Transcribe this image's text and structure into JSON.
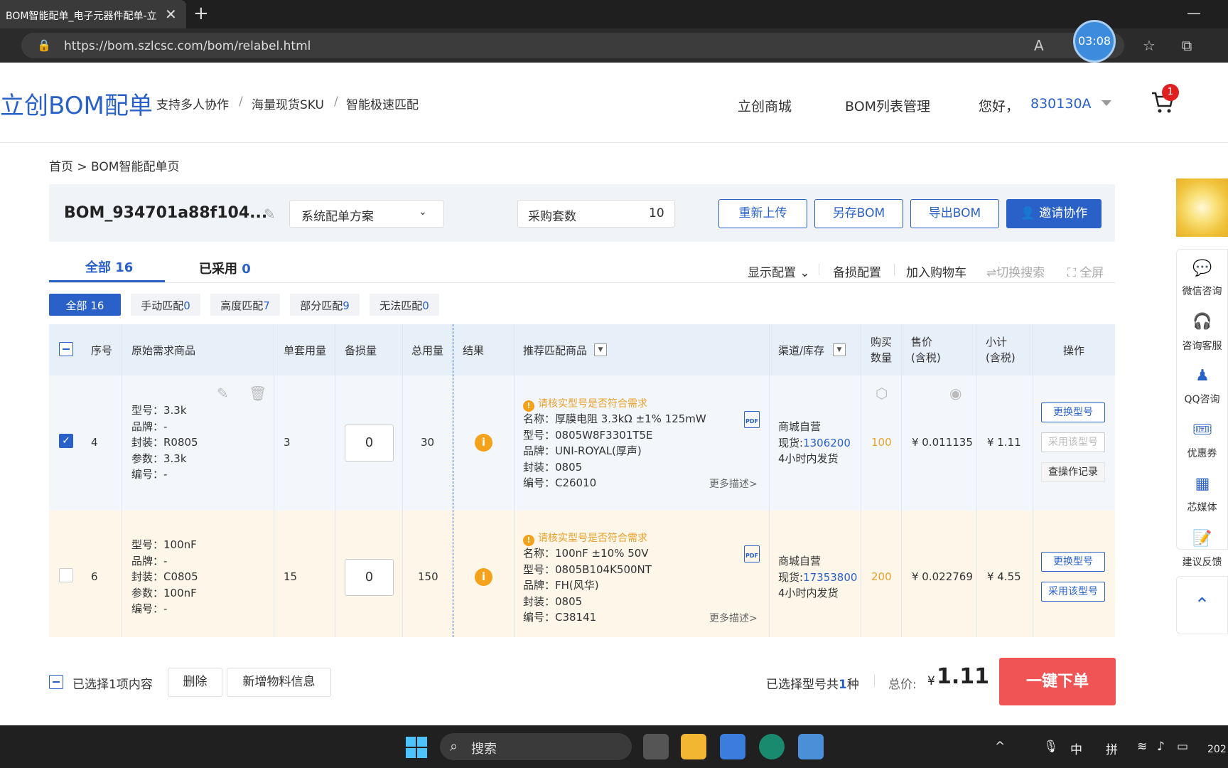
{
  "browser": {
    "tab_title": "BOM智能配单_电子元器件配单-立",
    "url": "https://bom.szlcsc.com/bom/relabel.html",
    "timer": "03:08"
  },
  "header": {
    "logo": "立创BOM配单",
    "slogans": [
      "支持多人协作",
      "/",
      "海量现货SKU",
      "/",
      "智能极速匹配"
    ],
    "nav": [
      "立创商城",
      "BOM列表管理"
    ],
    "greeting": "您好，",
    "user": "830130A",
    "cart_count": "1"
  },
  "breadcrumb": "首页 > BOM智能配单页",
  "bom": {
    "name": "BOM_934701a88f104...",
    "scheme": "系统配单方案",
    "qty_label": "采购套数",
    "qty_value": "10",
    "buttons": [
      "重新上传",
      "另存BOM",
      "导出BOM",
      "邀请协作"
    ]
  },
  "tabs": {
    "all_label": "全部 16",
    "used_label": "已采用 ",
    "used_count": "0"
  },
  "toolbar": [
    "显示配置",
    "备损配置",
    "加入购物车",
    "⇌切换搜索",
    "全屏"
  ],
  "chips": [
    {
      "label": "全部",
      "count": "16"
    },
    {
      "label": "手动匹配",
      "count": "0"
    },
    {
      "label": "高度匹配",
      "count": "7"
    },
    {
      "label": "部分匹配",
      "count": "9"
    },
    {
      "label": "无法匹配",
      "count": "0"
    }
  ],
  "columns": {
    "seq": "序号",
    "orig": "原始需求商品",
    "unit": "单套用量",
    "spare": "备损量",
    "total": "总用量",
    "result": "结果",
    "recommend": "推荐匹配商品",
    "channel": "渠道/库存",
    "buy1": "购买",
    "buy2": "数量",
    "price1": "售价",
    "price2": "(含税)",
    "sub1": "小计",
    "sub2": "(含税)",
    "op": "操作"
  },
  "rows": [
    {
      "seq": "4",
      "orig": [
        "型号：3.3k",
        "品牌：-",
        "封装：R0805",
        "参数：3.3k",
        "编号：-"
      ],
      "unit": "3",
      "spare": "0",
      "total": "30",
      "warn": "请核实型号是否符合需求",
      "rec": [
        "名称：厚膜电阻 3.3kΩ ±1% 125mW",
        "型号：0805W8F3301T5E",
        "品牌：UNI-ROYAL(厚声)",
        "封装：0805",
        "编号：C26010"
      ],
      "more": "更多描述>",
      "channel": "商城自营",
      "stock_label": "现货:",
      "stock": "1306200",
      "ship": "4小时内发货",
      "buy": "100",
      "price": "¥ 0.011135",
      "subtotal": "¥ 1.11",
      "ops": [
        "更换型号",
        "采用该型号",
        "查操作记录"
      ]
    },
    {
      "seq": "6",
      "orig": [
        "型号：100nF",
        "品牌：-",
        "封装：C0805",
        "参数：100nF",
        "编号：-"
      ],
      "unit": "15",
      "spare": "0",
      "total": "150",
      "warn": "请核实型号是否符合需求",
      "rec": [
        "名称：100nF ±10% 50V",
        "型号：0805B104K500NT",
        "品牌：FH(风华)",
        "封装：0805",
        "编号：C38141"
      ],
      "more": "更多描述>",
      "channel": "商城自营",
      "stock_label": "现货:",
      "stock": "17353800",
      "ship": "4小时内发货",
      "buy": "200",
      "price": "¥ 0.022769",
      "subtotal": "¥ 4.55",
      "ops": [
        "更换型号",
        "采用该型号"
      ]
    }
  ],
  "footer": {
    "selected": "已选择1项内容",
    "delete": "删除",
    "add": "新增物料信息",
    "summary_pre": "已选择型号共",
    "summary_count": "1",
    "summary_post": "种",
    "total_label": "总价:",
    "currency": "¥",
    "total": "1.11",
    "order": "一键下单"
  },
  "side": [
    "微信咨询",
    "咨询客服",
    "QQ咨询",
    "优惠券",
    "芯媒体",
    "建议反馈"
  ],
  "taskbar": {
    "search": "搜索",
    "ime1": "中",
    "ime2": "拼",
    "year": "202"
  }
}
